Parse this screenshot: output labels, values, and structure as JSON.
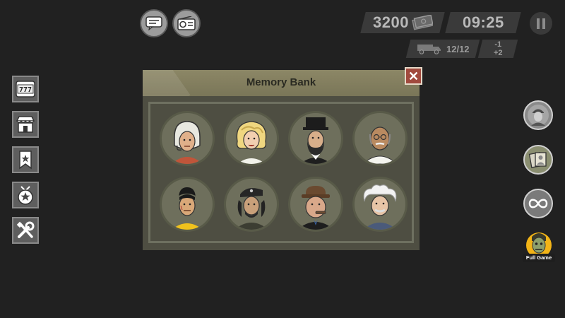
{
  "top": {
    "chat_icon": "chat-bubble-icon",
    "radio_icon": "radio-icon",
    "money": "3200",
    "time": "09:25",
    "vehicle_capacity": "12/12",
    "delta_minus": "-1",
    "delta_plus": "+2"
  },
  "left_sidebar": {
    "items": [
      {
        "name": "slot-machine-icon",
        "label": "777"
      },
      {
        "name": "shop-icon"
      },
      {
        "name": "bookmark-star-icon"
      },
      {
        "name": "badge-star-icon"
      },
      {
        "name": "tools-icon"
      }
    ]
  },
  "right_sidebar": {
    "full_game_label": "Full Game"
  },
  "modal": {
    "title": "Memory Bank",
    "close_glyph": "✕",
    "portraits": [
      {
        "name": "portrait-astronaut"
      },
      {
        "name": "portrait-blonde-woman"
      },
      {
        "name": "portrait-bearded-statesman"
      },
      {
        "name": "portrait-bald-sage"
      },
      {
        "name": "portrait-martial-artist"
      },
      {
        "name": "portrait-revolutionary"
      },
      {
        "name": "portrait-cigar-man"
      },
      {
        "name": "portrait-scientist"
      }
    ]
  },
  "colors": {
    "background": "#212121",
    "modal_header": "#8c8766",
    "modal_body": "#4e4e42",
    "close_button": "#a14a3e",
    "full_game_badge": "#f2b417"
  }
}
